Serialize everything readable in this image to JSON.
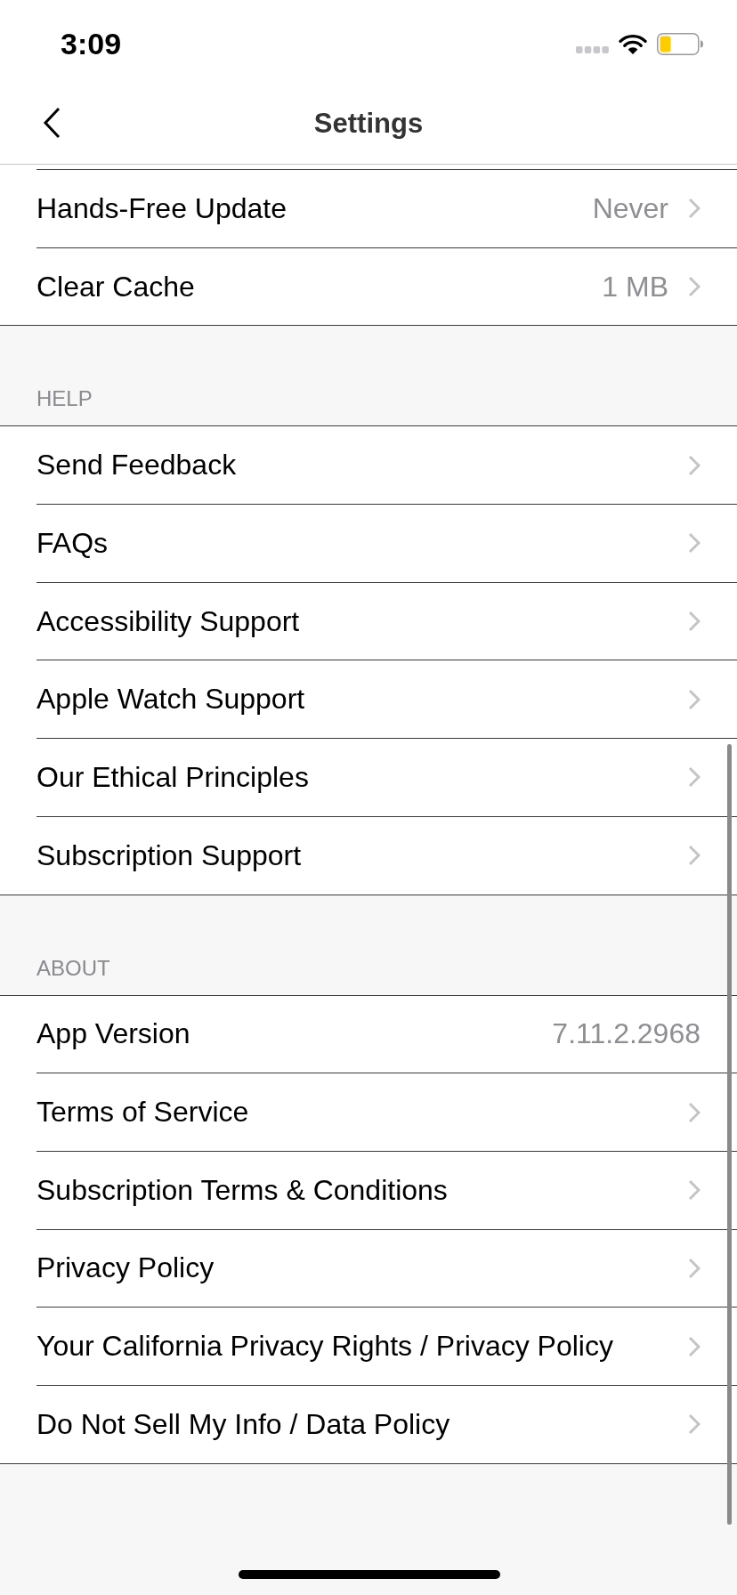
{
  "status_bar": {
    "time": "3:09"
  },
  "nav_bar": {
    "title": "Settings"
  },
  "sections": [
    {
      "rows": [
        {
          "label": "Hands-Free Update",
          "value": "Never",
          "kind": "disclosure"
        },
        {
          "label": "Clear Cache",
          "value": "1 MB",
          "kind": "disclosure"
        }
      ]
    },
    {
      "header": "HELP",
      "rows": [
        {
          "label": "Send Feedback",
          "kind": "disclosure"
        },
        {
          "label": "FAQs",
          "kind": "disclosure"
        },
        {
          "label": "Accessibility Support",
          "kind": "disclosure"
        },
        {
          "label": "Apple Watch Support",
          "kind": "disclosure"
        },
        {
          "label": "Our Ethical Principles",
          "kind": "disclosure"
        },
        {
          "label": "Subscription Support",
          "kind": "disclosure"
        }
      ]
    },
    {
      "header": "ABOUT",
      "rows": [
        {
          "label": "App Version",
          "value": "7.11.2.2968",
          "kind": "info"
        },
        {
          "label": "Terms of Service",
          "kind": "disclosure"
        },
        {
          "label": "Subscription Terms & Conditions",
          "kind": "disclosure"
        },
        {
          "label": "Privacy Policy",
          "kind": "disclosure"
        },
        {
          "label": "Your California Privacy Rights / Privacy Policy",
          "kind": "disclosure"
        },
        {
          "label": "Do Not Sell My Info / Data Policy",
          "kind": "disclosure"
        }
      ]
    }
  ]
}
